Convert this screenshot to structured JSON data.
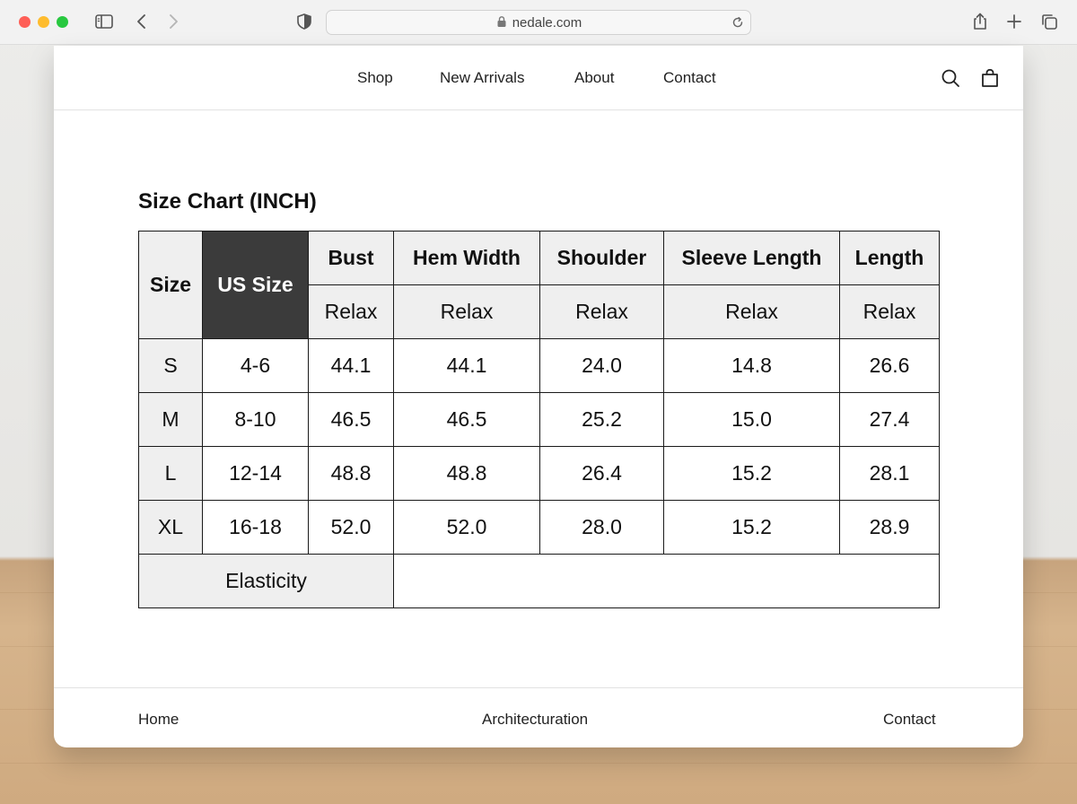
{
  "browser": {
    "url": "nedale.com",
    "icons": [
      "sidebar-icon",
      "back-icon",
      "forward-icon",
      "shield-icon",
      "lock-icon",
      "reload-icon",
      "share-icon",
      "new-tab-icon",
      "tabs-overview-icon"
    ]
  },
  "nav": {
    "links": [
      "Shop",
      "New Arrivals",
      "About",
      "Contact"
    ],
    "icons": [
      "search-icon",
      "bag-icon"
    ]
  },
  "main": {
    "title": "Size Chart (INCH)",
    "table": {
      "size_header": "Size",
      "us_size_header": "US Size",
      "measure_headers": [
        "Bust",
        "Hem Width",
        "Shoulder",
        "Sleeve Length",
        "Length"
      ],
      "fit_labels": [
        "Relax",
        "Relax",
        "Relax",
        "Relax",
        "Relax"
      ],
      "rows": [
        {
          "size": "S",
          "us": "4-6",
          "values": [
            "44.1",
            "44.1",
            "24.0",
            "14.8",
            "26.6"
          ]
        },
        {
          "size": "M",
          "us": "8-10",
          "values": [
            "46.5",
            "46.5",
            "25.2",
            "15.0",
            "27.4"
          ]
        },
        {
          "size": "L",
          "us": "12-14",
          "values": [
            "48.8",
            "48.8",
            "26.4",
            "15.2",
            "28.1"
          ]
        },
        {
          "size": "XL",
          "us": "16-18",
          "values": [
            "52.0",
            "52.0",
            "28.0",
            "15.2",
            "28.9"
          ]
        }
      ],
      "elasticity_label": "Elasticity",
      "elasticity_value": ""
    }
  },
  "footer": {
    "left": "Home",
    "center": "Architecturation",
    "right": "Contact"
  },
  "colors": {
    "header_fill": "#efefef",
    "us_size_fill": "#3b3b3b",
    "border": "#1a1a1a"
  }
}
